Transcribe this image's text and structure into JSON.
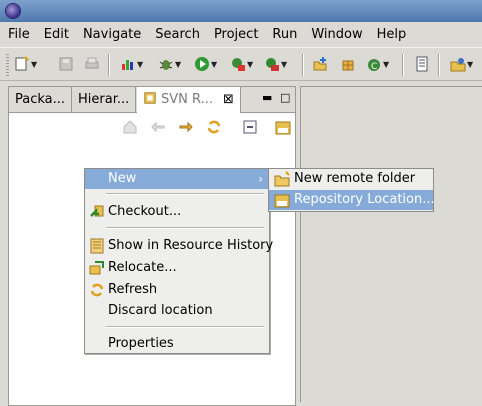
{
  "menubar": {
    "items": [
      {
        "label": "File"
      },
      {
        "label": "Edit"
      },
      {
        "label": "Navigate"
      },
      {
        "label": "Search"
      },
      {
        "label": "Project"
      },
      {
        "label": "Run"
      },
      {
        "label": "Window"
      },
      {
        "label": "Help"
      }
    ]
  },
  "tabs": [
    {
      "label": "Packa..."
    },
    {
      "label": "Hierar..."
    },
    {
      "label": "SVN R...",
      "close": "⊠"
    }
  ],
  "context_menu": {
    "new": "New",
    "checkout": "Checkout...",
    "show_history": "Show in Resource History",
    "relocate": "Relocate...",
    "refresh": "Refresh",
    "discard": "Discard location",
    "properties": "Properties",
    "submenu_arrow": "›"
  },
  "submenu": {
    "new_remote_folder": "New remote folder",
    "repository_location": "Repository Location..."
  },
  "colors": {
    "highlight": "#86abd9",
    "titlebar": "#4f77ad"
  }
}
